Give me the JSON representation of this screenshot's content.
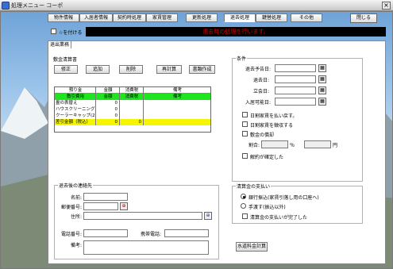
{
  "window": {
    "title": "処理メニュー コーポ",
    "close_glyph": "×"
  },
  "tabs": [
    {
      "label": "物件情報"
    },
    {
      "label": "入居者情報"
    },
    {
      "label": "契約時処理"
    },
    {
      "label": "家賃管理"
    },
    {
      "label": "更新処理"
    },
    {
      "label": "退去処理"
    },
    {
      "label": "鍵替処理"
    },
    {
      "label": "その他"
    }
  ],
  "active_tab": "退去処理",
  "close_button": "閉じる",
  "top_checkbox": {
    "label": "☆を付ける"
  },
  "status_message": "退去時の処理を行います。",
  "subtab": "退出業務",
  "settlement": {
    "group_title": "敷金清算書",
    "buttons": {
      "fix": "修正",
      "add": "追加",
      "delete": "削除",
      "recalc": "再計算",
      "document": "書類作成"
    },
    "columns": [
      "預り金",
      "金額",
      "消費税",
      "備考"
    ],
    "rows": [
      {
        "item": "敷引費用",
        "amount": "金額",
        "tax": "消費税",
        "note": "備考"
      },
      {
        "item": "畳の表替え",
        "amount": "0",
        "tax": "",
        "note": ""
      },
      {
        "item": "ハウスクリーニング",
        "amount": "0",
        "tax": "",
        "note": ""
      },
      {
        "item": "クーラーキャップ(2",
        "amount": "0",
        "tax": "",
        "note": ""
      },
      {
        "item": "差引金額（税込）",
        "amount": "0",
        "tax": "0",
        "note": ""
      }
    ]
  },
  "conditions": {
    "group_title": "条件",
    "fields": [
      {
        "label": "退去予告日:"
      },
      {
        "label": "退去日:"
      },
      {
        "label": "立会日:"
      },
      {
        "label": "入居可能日:"
      }
    ],
    "checks": [
      {
        "label": "日割家賃を払い戻す。"
      },
      {
        "label": "日割家賃を徴収する"
      },
      {
        "label": "敷金の償却"
      }
    ],
    "ratio_label": "割合:",
    "percent_unit": "％",
    "yen_unit": "円",
    "contract_check": "解約が確定した"
  },
  "contact": {
    "group_title": "退去後の連絡先",
    "name_label": "名前:",
    "zip_label": "郵便番号:",
    "address_label": "住所:",
    "phone_label": "電話番号:",
    "mobile_label": "携帯電話:",
    "note_label": "備考:"
  },
  "refund": {
    "group_title": "清算金の支払い",
    "radio_bank": "銀行振込(家賃引落し用の口座へ)",
    "radio_hand": "手渡す(振込以外)",
    "done_check": "清算金の支払いが完了した"
  },
  "water_button": "水道料金計算"
}
